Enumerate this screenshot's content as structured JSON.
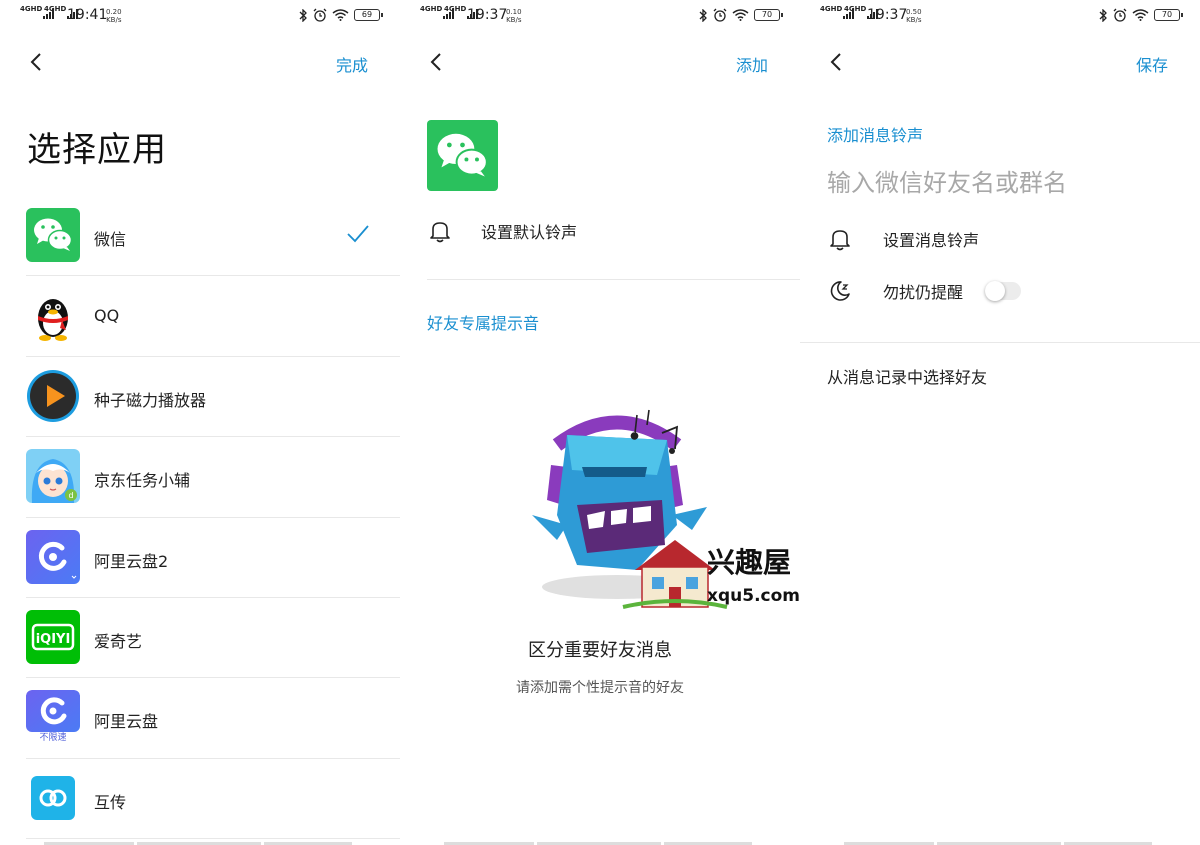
{
  "screens": [
    {
      "status": {
        "time": "19:41",
        "speed_value": "0.20",
        "speed_unit": "KB/s",
        "battery": "69",
        "net1": "4GHD",
        "net2": "4GHD"
      },
      "action_label": "完成",
      "title": "选择应用",
      "apps": [
        {
          "name": "微信",
          "icon": "wechat-icon",
          "selected": true
        },
        {
          "name": "QQ",
          "icon": "qq-penguin-icon",
          "selected": false
        },
        {
          "name": "种子磁力播放器",
          "icon": "play-icon",
          "selected": false
        },
        {
          "name": "京东任务小辅",
          "icon": "anime-girl-icon",
          "selected": false
        },
        {
          "name": "阿里云盘2",
          "icon": "aliyun-drive-icon",
          "selected": false
        },
        {
          "name": "爱奇艺",
          "icon": "iqiyi-icon",
          "selected": false
        },
        {
          "name": "阿里云盘",
          "icon": "aliyun-drive-icon",
          "selected": false,
          "badge": "不限速"
        },
        {
          "name": "互传",
          "icon": "link-icon",
          "selected": false
        }
      ]
    },
    {
      "status": {
        "time": "19:37",
        "speed_value": "0.10",
        "speed_unit": "KB/s",
        "battery": "70",
        "net1": "4GHD",
        "net2": "4GHD"
      },
      "action_label": "添加",
      "default_ringtone_label": "设置默认铃声",
      "section_title": "好友专属提示音",
      "watermark_cn": "兴趣屋",
      "watermark_url": "xqu5.com",
      "empty_title": "区分重要好友消息",
      "empty_subtitle": "请添加需个性提示音的好友"
    },
    {
      "status": {
        "time": "19:37",
        "speed_value": "0.50",
        "speed_unit": "KB/s",
        "battery": "70",
        "net1": "4GHD",
        "net2": "4GHD"
      },
      "action_label": "保存",
      "section_title": "添加消息铃声",
      "input_placeholder": "输入微信好友名或群名",
      "set_ringtone_label": "设置消息铃声",
      "dnd_label": "勿扰仍提醒",
      "dnd_enabled": false,
      "select_from_history_label": "从消息记录中选择好友"
    }
  ],
  "colors": {
    "accent": "#1a8fd0",
    "wechat_green": "#2ac15d",
    "divider": "#e8e8e8"
  }
}
